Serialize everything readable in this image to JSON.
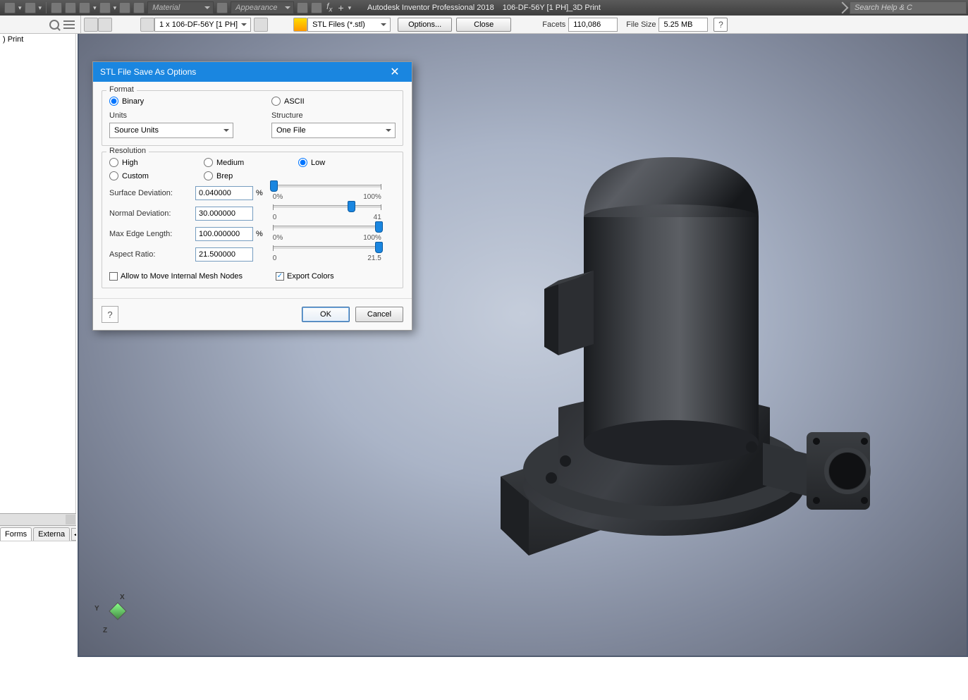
{
  "app": {
    "title_left": "Autodesk Inventor Professional 2018",
    "title_right": "106-DF-56Y [1 PH]_3D Print",
    "material_ddl": "Material",
    "appearance_ddl": "Appearance",
    "search_placeholder": "Search Help & C"
  },
  "toolbar": {
    "config_ddl": "1 x 106-DF-56Y [1 PH]",
    "filetype_ddl": "STL Files (*.stl)",
    "options_btn": "Options...",
    "close_btn": "Close",
    "facets_lbl": "Facets",
    "facets_val": "110,086",
    "filesize_lbl": "File Size",
    "filesize_val": "5.25 MB"
  },
  "leftpanel": {
    "item1": ") Print"
  },
  "tabs": {
    "tab1": "Forms",
    "tab2": "Externa"
  },
  "axes": {
    "x": "X",
    "y": "Y",
    "z": "Z"
  },
  "dialog": {
    "title": "STL File Save As Options",
    "format_legend": "Format",
    "binary": "Binary",
    "ascii": "ASCII",
    "units_lbl": "Units",
    "units_val": "Source Units",
    "structure_lbl": "Structure",
    "structure_val": "One File",
    "res_legend": "Resolution",
    "high": "High",
    "medium": "Medium",
    "low": "Low",
    "custom": "Custom",
    "brep": "Brep",
    "surfdev_lbl": "Surface Deviation:",
    "surfdev_val": "0.040000",
    "surfdev_min": "0%",
    "surfdev_max": "100%",
    "normdev_lbl": "Normal Deviation:",
    "normdev_val": "30.000000",
    "normdev_min": "0",
    "normdev_max": "41",
    "maxedge_lbl": "Max Edge Length:",
    "maxedge_val": "100.000000",
    "maxedge_min": "0%",
    "maxedge_max": "100%",
    "aspect_lbl": "Aspect Ratio:",
    "aspect_val": "21.500000",
    "aspect_min": "0",
    "aspect_max": "21.5",
    "allow_mesh": "Allow to Move Internal Mesh Nodes",
    "export_colors": "Export Colors",
    "ok": "OK",
    "cancel": "Cancel",
    "percent": "%"
  }
}
